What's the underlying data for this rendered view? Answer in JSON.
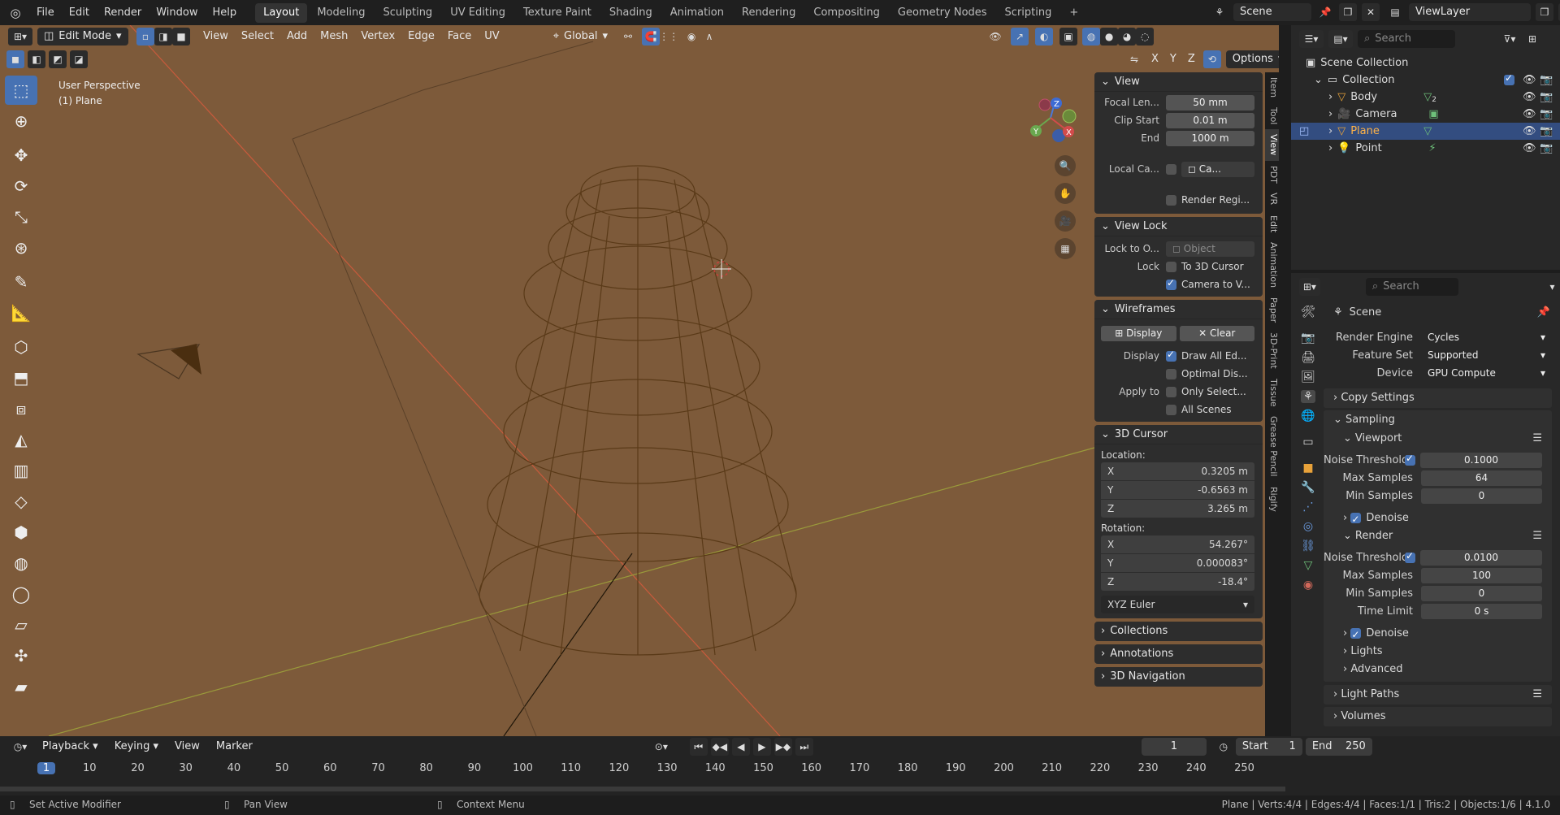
{
  "topbar": {
    "menus": [
      "File",
      "Edit",
      "Render",
      "Window",
      "Help"
    ],
    "workspaces": [
      "Layout",
      "Modeling",
      "Sculpting",
      "UV Editing",
      "Texture Paint",
      "Shading",
      "Animation",
      "Rendering",
      "Compositing",
      "Geometry Nodes",
      "Scripting"
    ],
    "active_workspace": "Layout",
    "scene": "Scene",
    "view_layer": "ViewLayer"
  },
  "viewport": {
    "mode": "Edit Mode",
    "menus": [
      "View",
      "Select",
      "Add",
      "Mesh",
      "Vertex",
      "Edge",
      "Face",
      "UV"
    ],
    "transform_orientation": "Global",
    "axes": [
      "X",
      "Y",
      "Z"
    ],
    "options_label": "Options",
    "overlay_title": "User Perspective",
    "overlay_object": "(1) Plane",
    "gizmo": {
      "z": "Z",
      "y": "Y",
      "x": "X"
    },
    "background_color": "#7d5a3a"
  },
  "npanel": {
    "view": {
      "title": "View",
      "focal_label": "Focal Len...",
      "focal_value": "50 mm",
      "clip_start_label": "Clip Start",
      "clip_start_value": "0.01 m",
      "end_label": "End",
      "end_value": "1000 m",
      "local_camera_label": "Local Ca...",
      "local_camera_value": "Ca...",
      "render_region": "Render Regi..."
    },
    "view_lock": {
      "title": "View Lock",
      "lock_to_label": "Lock to O...",
      "lock_to_placeholder": "Object",
      "lock_label": "Lock",
      "to_cursor": "To 3D Cursor",
      "camera_to_view": "Camera to V..."
    },
    "wireframes": {
      "title": "Wireframes",
      "display_btn": "Display",
      "clear_btn": "Clear",
      "display_label": "Display",
      "draw_all": "Draw All Ed...",
      "optimal": "Optimal Dis...",
      "apply_to_label": "Apply to",
      "only_selected": "Only Select...",
      "all_scenes": "All Scenes"
    },
    "cursor": {
      "title": "3D Cursor",
      "location_label": "Location:",
      "loc": [
        {
          "axis": "X",
          "value": "0.3205 m"
        },
        {
          "axis": "Y",
          "value": "-0.6563 m"
        },
        {
          "axis": "Z",
          "value": "3.265 m"
        }
      ],
      "rotation_label": "Rotation:",
      "rot": [
        {
          "axis": "X",
          "value": "54.267°"
        },
        {
          "axis": "Y",
          "value": "0.000083°"
        },
        {
          "axis": "Z",
          "value": "-18.4°"
        }
      ],
      "rot_mode": "XYZ Euler"
    },
    "collapsed": [
      "Collections",
      "Annotations",
      "3D Navigation"
    ],
    "tabs": [
      "Item",
      "Tool",
      "View",
      "PDT",
      "VR",
      "Edit",
      "Animation",
      "Paper",
      "3D-Print",
      "Tissue",
      "Grease Pencil",
      "Rigify"
    ],
    "active_tab": "View"
  },
  "outliner": {
    "search_placeholder": "Search",
    "root": "Scene Collection",
    "collection": "Collection",
    "items": [
      {
        "name": "Body",
        "icon": "mesh-icon",
        "extra": "2"
      },
      {
        "name": "Camera",
        "icon": "camera-icon",
        "extra": ""
      },
      {
        "name": "Plane",
        "icon": "mesh-icon",
        "extra": ""
      },
      {
        "name": "Point",
        "icon": "light-icon",
        "extra": ""
      }
    ]
  },
  "properties": {
    "search_placeholder": "Search",
    "context": "Scene",
    "render_engine_label": "Render Engine",
    "render_engine": "Cycles",
    "feature_set_label": "Feature Set",
    "feature_set": "Supported",
    "device_label": "Device",
    "device": "GPU Compute",
    "copy_settings": "Copy Settings",
    "sampling": "Sampling",
    "viewport": "Viewport",
    "vp_noise_label": "Noise Threshold",
    "vp_noise": "0.1000",
    "vp_max_label": "Max Samples",
    "vp_max": "64",
    "vp_min_label": "Min Samples",
    "vp_min": "0",
    "denoise": "Denoise",
    "render": "Render",
    "r_noise_label": "Noise Threshold",
    "r_noise": "0.0100",
    "r_max_label": "Max Samples",
    "r_max": "100",
    "r_min_label": "Min Samples",
    "r_min": "0",
    "time_limit_label": "Time Limit",
    "time_limit": "0 s",
    "denoise2": "Denoise",
    "lights": "Lights",
    "advanced": "Advanced",
    "light_paths": "Light Paths",
    "volumes": "Volumes"
  },
  "timeline": {
    "menus": [
      "Playback",
      "Keying",
      "View",
      "Marker"
    ],
    "current_frame": "1",
    "start_label": "Start",
    "start": "1",
    "end_label": "End",
    "end": "250",
    "ruler": [
      "1",
      "10",
      "20",
      "30",
      "40",
      "50",
      "60",
      "70",
      "80",
      "90",
      "100",
      "110",
      "120",
      "130",
      "140",
      "150",
      "160",
      "170",
      "180",
      "190",
      "200",
      "210",
      "220",
      "230",
      "240",
      "250"
    ]
  },
  "status": {
    "left": "Set Active Modifier",
    "mid": "Pan View",
    "right": "Context Menu",
    "stats": "Plane | Verts:4/4 | Edges:4/4 | Faces:1/1 | Tris:2 | Objects:1/6 | 4.1.0"
  }
}
